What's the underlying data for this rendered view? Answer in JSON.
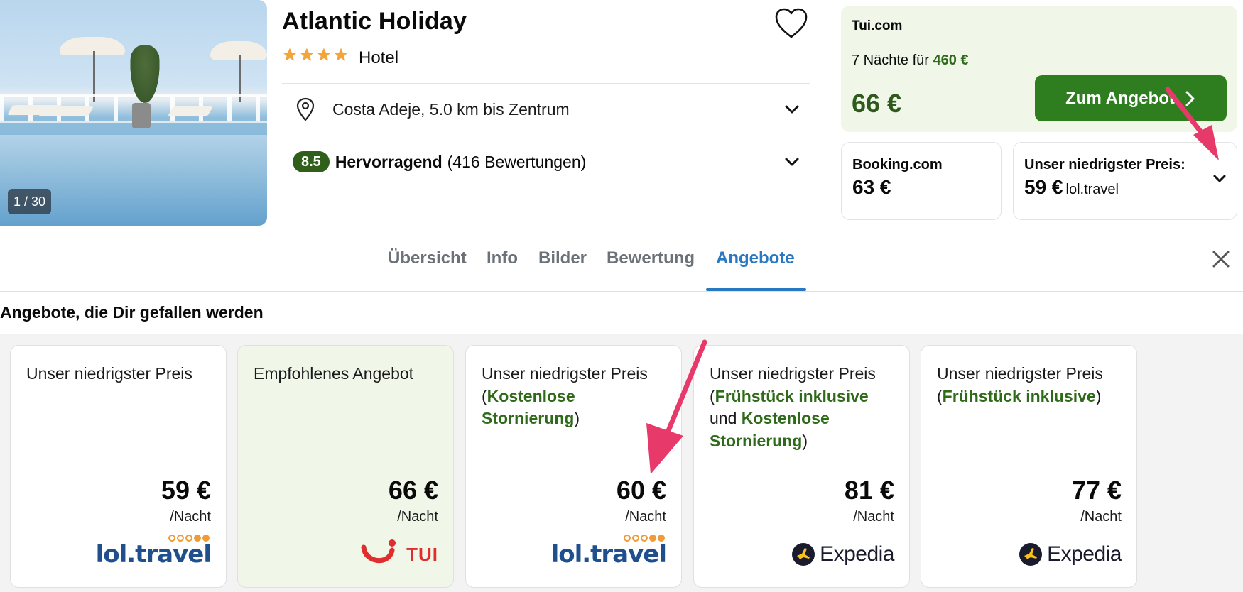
{
  "photo": {
    "counter": "1 / 30"
  },
  "hotel": {
    "title": "Atlantic Holiday",
    "stars": 4,
    "type": "Hotel"
  },
  "location": {
    "text": "Costa Adeje, 5.0 km bis Zentrum"
  },
  "rating": {
    "score": "8.5",
    "word": "Hervorragend",
    "count": "(416 Bewertungen)"
  },
  "featured_price": {
    "provider": "Tui.com",
    "nights_prefix": "7 Nächte für",
    "nights_total": "460 €",
    "price": "66 €",
    "cta_label": "Zum Angebot"
  },
  "alt_prices": [
    {
      "provider": "Booking.com",
      "price": "63 €"
    },
    {
      "label": "Unser niedrigster Preis:",
      "price": "59 €",
      "provider": "lol.travel"
    }
  ],
  "tabs": [
    "Übersicht",
    "Info",
    "Bilder",
    "Bewertung",
    "Angebote"
  ],
  "active_tab": "Angebote",
  "section_title": "Angebote, die Dir gefallen werden",
  "offers": [
    {
      "label_parts": [
        {
          "t": "Unser niedrigster Preis",
          "hl": false
        }
      ],
      "price": "59 €",
      "unit": "/Nacht",
      "provider": "lol.travel",
      "logo": "lol-travel-logo"
    },
    {
      "label_parts": [
        {
          "t": "Empfohlenes Angebot",
          "hl": false
        }
      ],
      "price": "66 €",
      "unit": "/Nacht",
      "provider": "TUI",
      "logo": "tui-logo"
    },
    {
      "label_parts": [
        {
          "t": "Unser niedrigster Preis (",
          "hl": false
        },
        {
          "t": "Kostenlose Stornierung",
          "hl": true
        },
        {
          "t": ")",
          "hl": false
        }
      ],
      "price": "60 €",
      "unit": "/Nacht",
      "provider": "lol.travel",
      "logo": "lol-travel-logo"
    },
    {
      "label_parts": [
        {
          "t": "Unser niedrigster Preis (",
          "hl": false
        },
        {
          "t": "Frühstück inklusive",
          "hl": true
        },
        {
          "t": " und ",
          "hl": false
        },
        {
          "t": "Kostenlose Stornierung",
          "hl": true
        },
        {
          "t": ")",
          "hl": false
        }
      ],
      "price": "81 €",
      "unit": "/Nacht",
      "provider": "Expedia",
      "logo": "expedia-logo"
    },
    {
      "label_parts": [
        {
          "t": "Unser niedrigster Preis (",
          "hl": false
        },
        {
          "t": "Frühstück inklusive",
          "hl": true
        },
        {
          "t": ")",
          "hl": false
        }
      ],
      "price": "77 €",
      "unit": "/Nacht",
      "provider": "Expedia",
      "logo": "expedia-logo"
    }
  ],
  "colors": {
    "brand_green": "#2e7d1f",
    "highlight_green": "#2f6a1a",
    "tab_active": "#2979c2",
    "star": "#f2a53a",
    "annotation": "#e8396b"
  }
}
